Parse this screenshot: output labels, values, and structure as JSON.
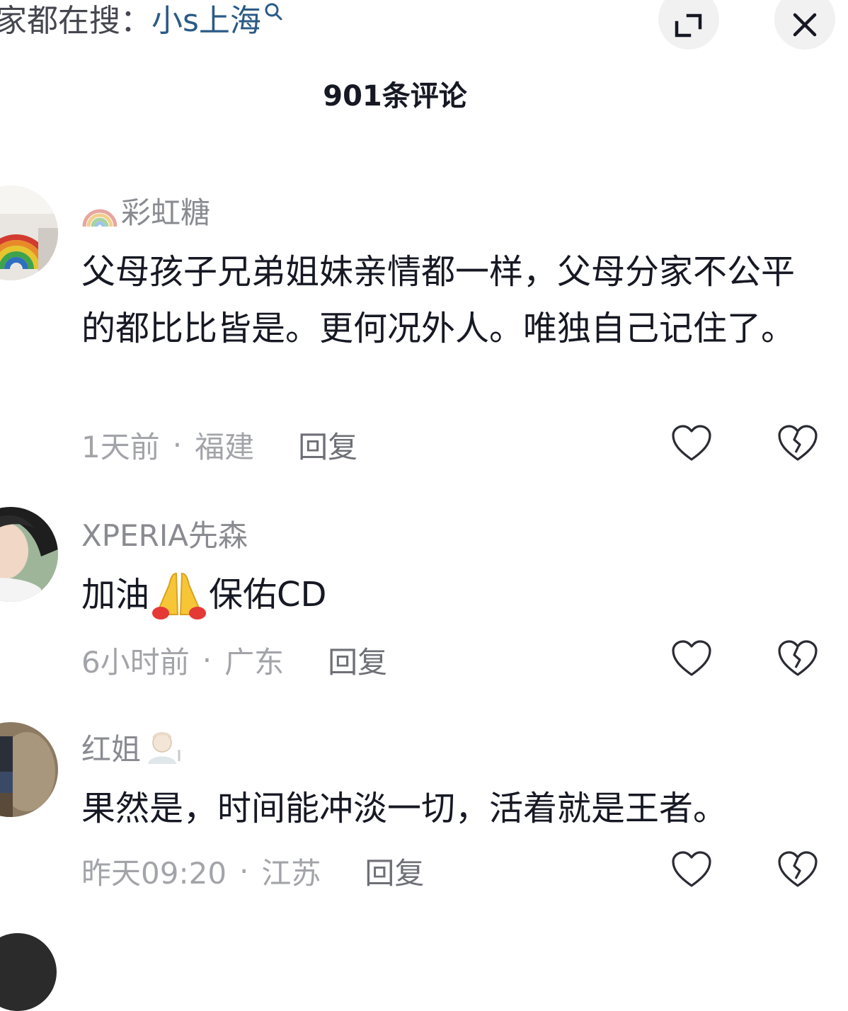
{
  "header": {
    "search_prefix": "家都在搜：",
    "search_term": "小s上海",
    "sheet_title": "901条评论"
  },
  "icons": {
    "search": "search-icon",
    "expand": "expand-icon",
    "close": "close-icon",
    "like": "heart-outline-icon",
    "dislike": "broken-heart-icon"
  },
  "comments": [
    {
      "username": "彩虹糖",
      "text": "父母孩子兄弟姐妹亲情都一样，父母分家不公平的都比比皆是。更何况外人。唯独自己记住了。",
      "time": "1天前",
      "location": "福建",
      "reply_label": "回复"
    },
    {
      "username": "XPERIA先森",
      "text_before": "加油",
      "text_after": "保佑CD",
      "time": "6小时前",
      "location": "广东",
      "reply_label": "回复"
    },
    {
      "username": "红姐",
      "text": "果然是，时间能冲淡一切，活着就是王者。",
      "time": "昨天09:20",
      "location": "江苏",
      "reply_label": "回复"
    }
  ],
  "meta_separator": "·",
  "colors": {
    "text_primary": "#161823",
    "text_secondary": "#8a8b91",
    "meta": "#a3a4a9",
    "search_term": "#2b5a86",
    "button_bg": "#f1f1f2"
  }
}
